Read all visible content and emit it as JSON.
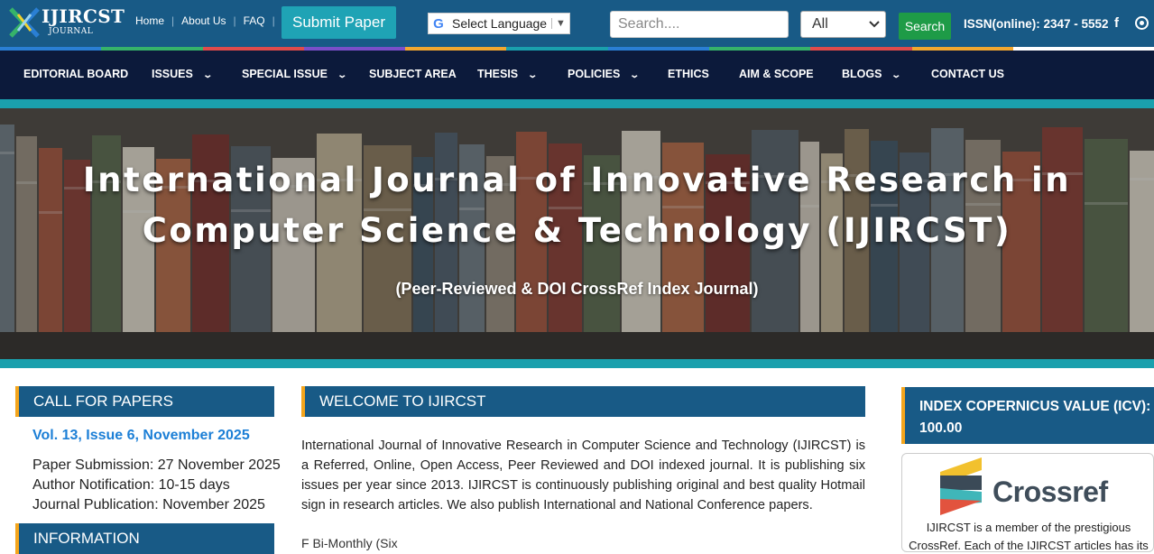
{
  "header": {
    "logo_text": "IJIRCST",
    "logo_subtext": "JOURNAL",
    "top_links": [
      "Home",
      "About Us",
      "FAQ"
    ],
    "submit_label": "Submit Paper",
    "language_label": "Select Language",
    "search_placeholder": "Search....",
    "filter_selected": "All",
    "search_button": "Search",
    "issn": "ISSN(online): 2347 - 5552",
    "facebook_icon": "f"
  },
  "stripe_colors": [
    "#2a7fd4",
    "#36b36a",
    "#e04b4b",
    "#7b4fc9",
    "#f2a72f",
    "#1aa0ad",
    "#2a7fd4",
    "#36b36a",
    "#e04b4b",
    "#f2a72f"
  ],
  "nav": {
    "items": [
      {
        "label": "EDITORIAL BOARD",
        "dropdown": false
      },
      {
        "label": "ISSUES",
        "dropdown": true
      },
      {
        "label": "SPECIAL ISSUE",
        "dropdown": true
      },
      {
        "label": "SUBJECT AREA",
        "dropdown": false
      },
      {
        "label": "THESIS",
        "dropdown": true
      },
      {
        "label": "POLICIES",
        "dropdown": true
      },
      {
        "label": "ETHICS",
        "dropdown": false
      },
      {
        "label": "AIM & SCOPE",
        "dropdown": false
      },
      {
        "label": "BLOGS",
        "dropdown": true
      },
      {
        "label": "CONTACT US",
        "dropdown": false
      }
    ]
  },
  "hero": {
    "title_line1": "International Journal of Innovative Research in",
    "title_line2": "Computer Science & Technology (IJIRCST)",
    "subtitle": "(Peer-Reviewed & DOI CrossRef Index Journal)"
  },
  "call_for_papers": {
    "heading": "CALL FOR PAPERS",
    "volume": "Vol. 13, Issue 6, November 2025",
    "submission": "Paper Submission: 27 November 2025",
    "notification": "Author Notification: 10-15 days",
    "publication": "Journal Publication: November 2025"
  },
  "information": {
    "heading": "INFORMATION"
  },
  "welcome": {
    "heading": "WELCOME TO IJIRCST",
    "body": "International Journal of Innovative Research in Computer Science and Technology (IJIRCST) is a Referred, Online, Open Access, Peer Reviewed and DOI indexed journal. It is publishing six issues per year since 2013. IJIRCST is continuously publishing original and best quality Hotmail sign in research articles. We also publish International and National Conference papers.",
    "next_line": "F              Bi-Monthly (Six"
  },
  "icv": {
    "heading_line1": "INDEX COPERNICUS VALUE (ICV):",
    "heading_line2": "100.00"
  },
  "crossref": {
    "brand": "Crossref",
    "text_line1": "IJIRCST is a member of the prestigious",
    "text_line2": "CrossRef. Each of the IJIRCST articles has its"
  }
}
